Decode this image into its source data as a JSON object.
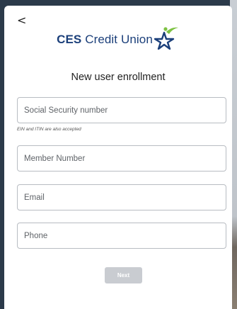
{
  "nav": {
    "back_label": "<"
  },
  "brand": {
    "bold": "CES",
    "rest": "Credit Union",
    "logo_icon": "star-swoosh-icon"
  },
  "page": {
    "title": "New user enrollment"
  },
  "form": {
    "ssn": {
      "placeholder": "Social Security number",
      "value": ""
    },
    "ssn_hint": "EIN and ITIN are also accepted",
    "member_number": {
      "placeholder": "Member Number",
      "value": ""
    },
    "email": {
      "placeholder": "Email",
      "value": ""
    },
    "phone": {
      "placeholder": "Phone",
      "value": ""
    }
  },
  "actions": {
    "next_label": "Next"
  },
  "colors": {
    "brand_blue": "#1b3f7a",
    "brand_green": "#7dc242",
    "button_disabled": "#c9ccd1"
  }
}
